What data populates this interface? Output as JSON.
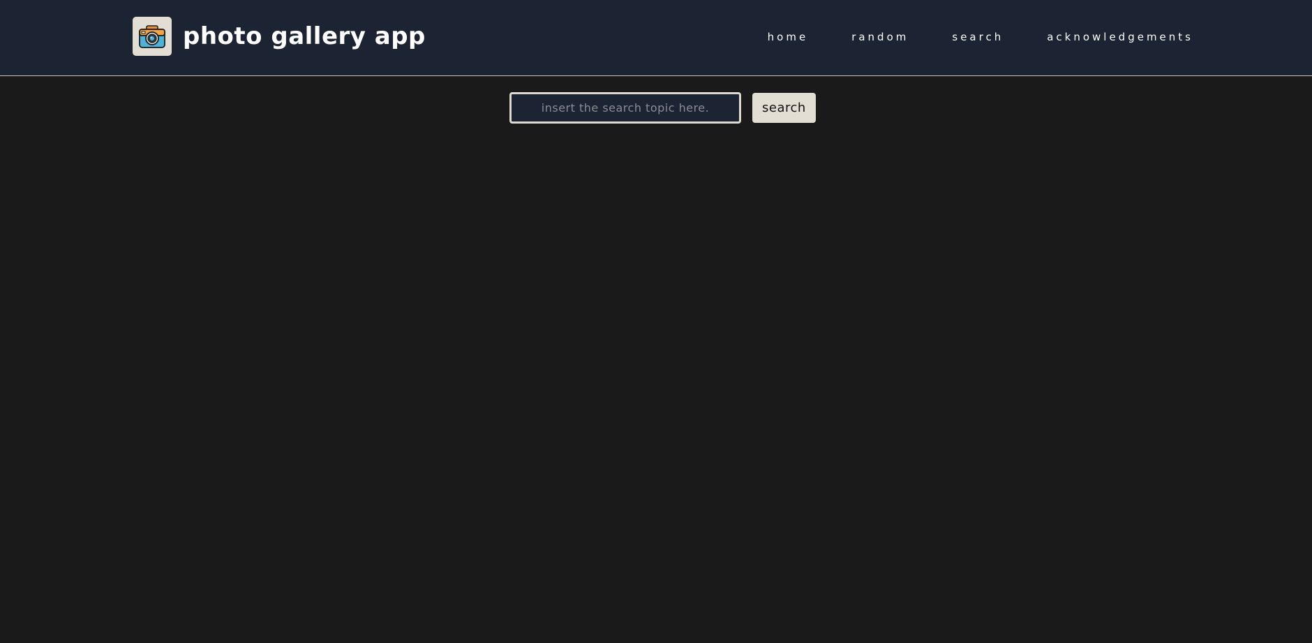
{
  "header": {
    "title": "photo gallery app",
    "logo_icon": "camera-icon",
    "background": "#1c2332"
  },
  "nav": {
    "items": [
      {
        "label": "home"
      },
      {
        "label": "random"
      },
      {
        "label": "search"
      },
      {
        "label": "acknowledgements"
      }
    ]
  },
  "search": {
    "value": "",
    "placeholder": "insert the search topic here.",
    "button_label": "search"
  },
  "colors": {
    "page_background": "#1a1a1a",
    "accent": "#e2ded3"
  }
}
